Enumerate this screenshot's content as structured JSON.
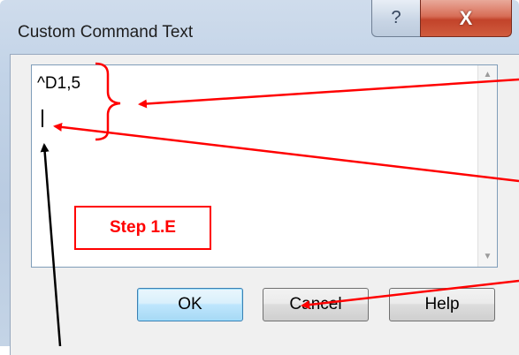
{
  "window": {
    "title": "Custom Command Text",
    "help_glyph": "?",
    "close_glyph": "X"
  },
  "editor": {
    "command_text": "^D1,5"
  },
  "annotation": {
    "step_label": "Step 1.E",
    "color": "#ff0000"
  },
  "buttons": {
    "ok": "OK",
    "cancel": "Cancel",
    "help": "Help"
  },
  "scrollbar": {
    "up_glyph": "▲",
    "down_glyph": "▼"
  }
}
